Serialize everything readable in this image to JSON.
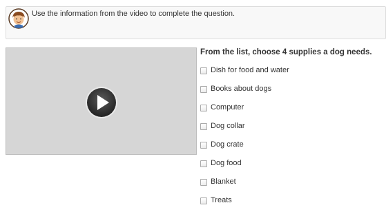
{
  "instruction": {
    "avatar_icon": "student-avatar-icon",
    "text": "Use the information from the video to complete the question."
  },
  "video": {
    "play_icon": "play-icon",
    "background_color": "#d6d6d6"
  },
  "question": {
    "title": "From the list, choose 4 supplies a dog needs.",
    "options": [
      {
        "label": "Dish for food and water",
        "checked": false
      },
      {
        "label": "Books about dogs",
        "checked": false
      },
      {
        "label": "Computer",
        "checked": false
      },
      {
        "label": "Dog collar",
        "checked": false
      },
      {
        "label": "Dog crate",
        "checked": false
      },
      {
        "label": "Dog food",
        "checked": false
      },
      {
        "label": "Blanket",
        "checked": false
      },
      {
        "label": "Treats",
        "checked": false
      }
    ]
  }
}
